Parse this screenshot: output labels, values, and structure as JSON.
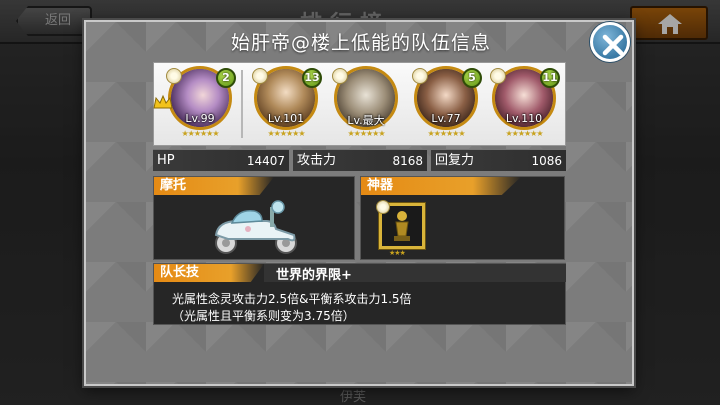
{
  "background": {
    "title": "排行榜",
    "back_label": "返回",
    "bottom_text": "伊芙"
  },
  "modal": {
    "title": "始肝帝@楼上低能的队伍信息"
  },
  "team": [
    {
      "level": "Lv.99",
      "cost": "2",
      "leader": true,
      "stars": "★★★★★★"
    },
    {
      "level": "Lv.101",
      "cost": "13",
      "leader": false,
      "stars": "★★★★★★"
    },
    {
      "level": "Lv.最大",
      "cost": "",
      "leader": false,
      "stars": "★★★★★★"
    },
    {
      "level": "Lv.77",
      "cost": "5",
      "leader": false,
      "stars": "★★★★★★"
    },
    {
      "level": "Lv.110",
      "cost": "11",
      "leader": false,
      "stars": "★★★★★★"
    }
  ],
  "stats": {
    "hp_label": "HP",
    "hp_value": "14407",
    "atk_label": "攻击力",
    "atk_value": "8168",
    "rec_label": "回复力",
    "rec_value": "1086"
  },
  "mount": {
    "label": "摩托"
  },
  "artifact": {
    "label": "神器",
    "stars": "★★★"
  },
  "leader_skill": {
    "label": "队长技",
    "name": "世界的界限+",
    "desc_line1": "光属性念灵攻击力2.5倍&平衡系攻击力1.5倍",
    "desc_line2": "（光属性且平衡系则变为3.75倍）"
  },
  "icons": {
    "back": "back-arrow-icon",
    "home": "home-icon",
    "close": "close-icon",
    "crown": "crown-icon",
    "attribute": "light-attribute-icon"
  },
  "colors": {
    "accent_orange": "#e58a14",
    "cost_green": "#6fae1c",
    "close_blue": "#3a7aa5",
    "ring_gold": "#c58a12"
  }
}
